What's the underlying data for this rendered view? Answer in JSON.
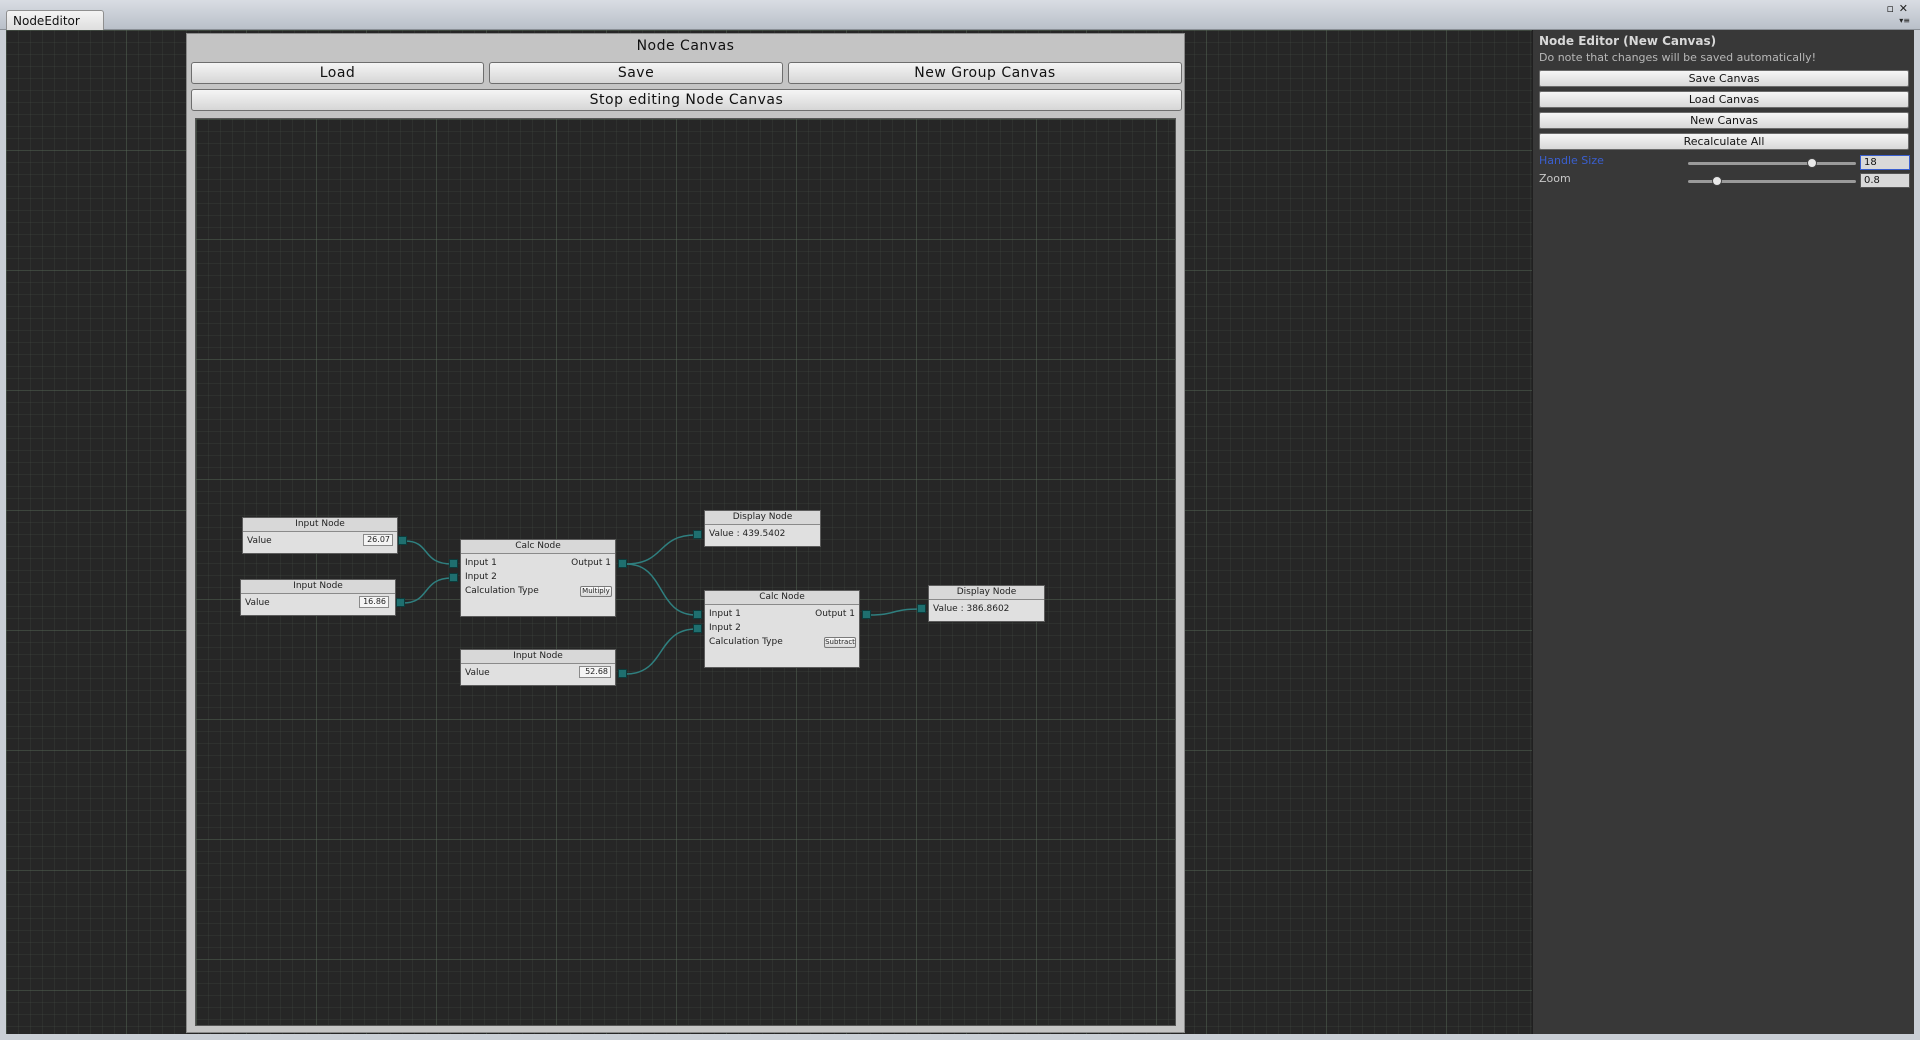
{
  "window": {
    "tab_title": "NodeEditor",
    "controls": [
      "▫",
      "✕"
    ]
  },
  "colors": {
    "grid_bg": "#262626",
    "wire": "#2f7f7f",
    "accent_label": "#3a5fcf"
  },
  "canvas_window": {
    "title": "Node Canvas",
    "buttons": {
      "load": "Load",
      "save": "Save",
      "new_group": "New Group Canvas",
      "stop_editing": "Stop editing Node Canvas"
    }
  },
  "nodes": {
    "input1": {
      "title": "Input Node",
      "label": "Value",
      "value": "26.07"
    },
    "input2": {
      "title": "Input Node",
      "label": "Value",
      "value": "16.86"
    },
    "input3": {
      "title": "Input Node",
      "label": "Value",
      "value": "52.68"
    },
    "calc1": {
      "title": "Calc Node",
      "input1": "Input 1",
      "input2": "Input 2",
      "output": "Output 1",
      "calc_label": "Calculation Type",
      "calc_value": "Multiply"
    },
    "calc2": {
      "title": "Calc Node",
      "input1": "Input 1",
      "input2": "Input 2",
      "output": "Output 1",
      "calc_label": "Calculation Type",
      "calc_value": "Subtract"
    },
    "display1": {
      "title": "Display Node",
      "value_text": "Value : 439.5402"
    },
    "display2": {
      "title": "Display Node",
      "value_text": "Value : 386.8602"
    }
  },
  "panel": {
    "title": "Node Editor (New Canvas)",
    "note": "Do note that changes will be saved automatically!",
    "buttons": {
      "save_canvas": "Save Canvas",
      "load_canvas": "Load Canvas",
      "new_canvas": "New Canvas",
      "recalculate": "Recalculate All"
    },
    "handle_size": {
      "label": "Handle Size",
      "value": "18",
      "slider_fraction": 0.75
    },
    "zoom": {
      "label": "Zoom",
      "value": "0.8",
      "slider_fraction": 0.15
    }
  }
}
